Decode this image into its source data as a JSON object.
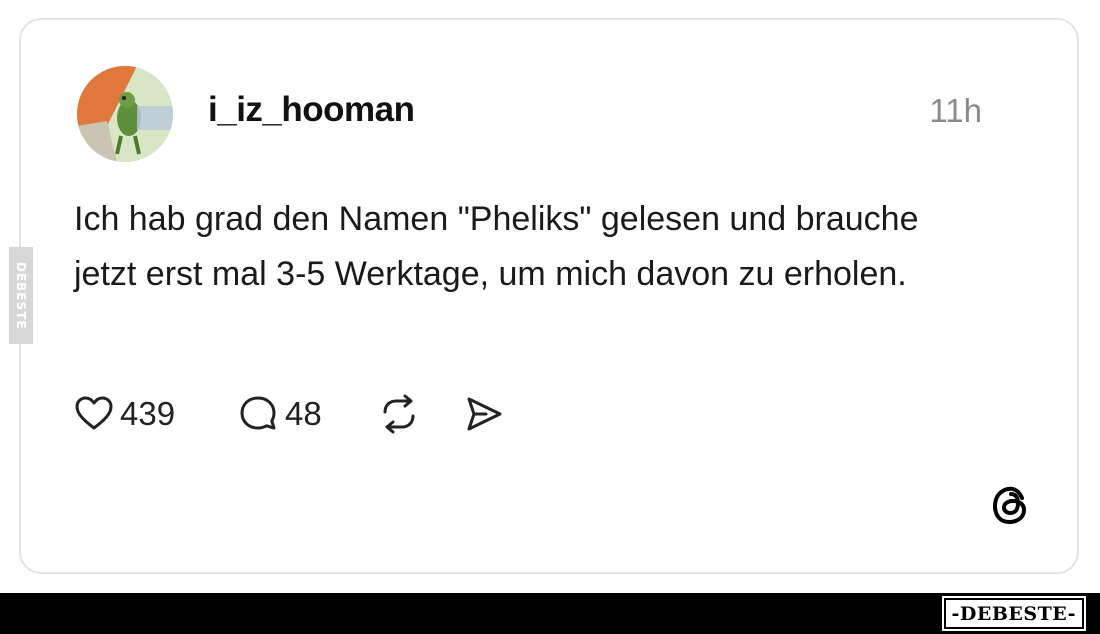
{
  "post": {
    "username": "i_iz_hooman",
    "time_ago": "11h",
    "text": "Ich hab grad den Namen \"Pheliks\" gelesen und brauche jetzt erst mal 3-5 Werktage, um mich davon zu erholen.",
    "likes": "439",
    "replies": "48",
    "icons": [
      "heart-icon",
      "comment-icon",
      "repost-icon",
      "share-icon",
      "threads-logo-icon"
    ]
  },
  "watermark": {
    "side_text": "DEBESTE",
    "footer_text": "-DEBESTE-"
  },
  "colors": {
    "card_border": "#e3e3e3",
    "text": "#1a1a1a",
    "muted": "#8a8a8a",
    "footer_bar": "#000000"
  }
}
